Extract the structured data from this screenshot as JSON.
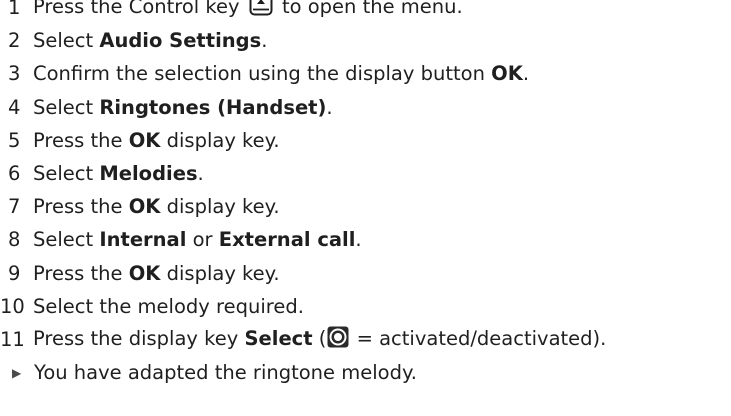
{
  "steps": [
    {
      "num": "1",
      "parts": [
        "Press the Control key ",
        " to open the menu."
      ]
    },
    {
      "num": "2",
      "pre": "Select ",
      "bold": "Audio Settings",
      "post": "."
    },
    {
      "num": "3",
      "pre": "Confirm the selection using the display button ",
      "bold": "OK",
      "post": "."
    },
    {
      "num": "4",
      "pre": "Select ",
      "bold": "Ringtones (Handset)",
      "post": "."
    },
    {
      "num": "5",
      "pre": "Press the ",
      "bold": "OK",
      "post": " display key."
    },
    {
      "num": "6",
      "pre": "Select ",
      "bold": "Melodies",
      "post": "."
    },
    {
      "num": "7",
      "pre": "Press the ",
      "bold": "OK",
      "post": " display key."
    },
    {
      "num": "8",
      "pre": "Select ",
      "bold": "Internal",
      "mid": " or ",
      "bold2": "External call",
      "post": "."
    },
    {
      "num": "9",
      "pre": "Press the ",
      "bold": "OK",
      "post": " display key."
    },
    {
      "num": "10",
      "pre": "Select the melody required."
    },
    {
      "num": "11",
      "pre": "Press the display key ",
      "bold": "Select",
      "mid": " (",
      "post": " = activated/deactivated)."
    }
  ],
  "result": "You have adapted the ringtone melody.",
  "icons": {
    "control_key": "control-key-icon",
    "radio": "radio-button-icon",
    "result_arrow": "arrow-right-icon"
  }
}
